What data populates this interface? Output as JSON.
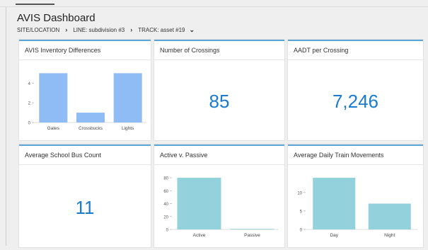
{
  "header": {
    "title": "AVIS Dashboard"
  },
  "breadcrumb": {
    "site": "SITE/LOCATION",
    "line": "LINE: subdivision #3",
    "track": "TRACK: asset #19"
  },
  "cards": {
    "inventory": {
      "title": "AVIS Inventory Differences"
    },
    "crossings": {
      "title": "Number of Crossings",
      "value": "85"
    },
    "aadt": {
      "title": "AADT per Crossing",
      "value": "7,246"
    },
    "school_bus": {
      "title": "Average School Bus Count",
      "value": "11"
    },
    "active_passive": {
      "title": "Active v. Passive"
    },
    "train": {
      "title": "Average Daily Train Movements"
    }
  },
  "colors": {
    "accent": "#5ba4d6",
    "bar_blue": "#8fbcf5",
    "bar_teal": "#93d1dd",
    "value_blue": "#1a7bd1"
  },
  "chart_data": [
    {
      "type": "bar",
      "categories": [
        "Gates",
        "Crossbucks",
        "Lights"
      ],
      "values": [
        5,
        1,
        5
      ],
      "yticks": [
        0,
        2,
        4
      ],
      "ylim": [
        0,
        5.6
      ],
      "color": "#8fbcf5"
    },
    {
      "type": "bar",
      "categories": [
        "Active",
        "Passive"
      ],
      "values": [
        80,
        1
      ],
      "yticks": [
        0,
        20,
        40,
        60,
        80
      ],
      "ylim": [
        0,
        80
      ],
      "color": "#93d1dd"
    },
    {
      "type": "bar",
      "categories": [
        "Day",
        "Night"
      ],
      "values": [
        14,
        7
      ],
      "yticks": [
        0,
        5,
        10
      ],
      "ylim": [
        0,
        14
      ],
      "color": "#93d1dd"
    }
  ]
}
